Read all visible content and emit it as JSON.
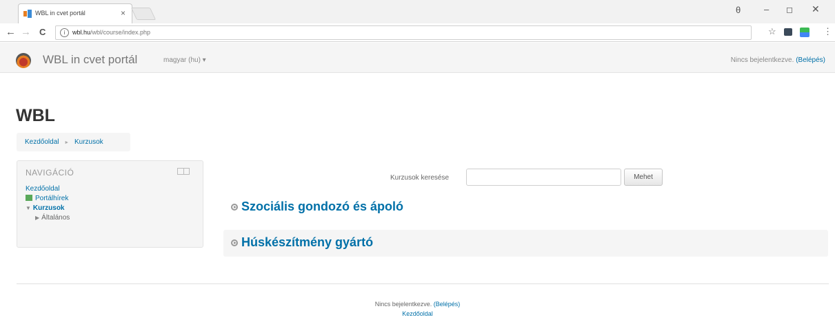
{
  "browser": {
    "tab_title": "WBL in cvet portál",
    "tab_close": "×",
    "url_host": "wbl.hu",
    "url_path": "/wbl/course/index.php",
    "profile_icon": "θ",
    "minimize": "–",
    "maximize": "◻",
    "close": "✕",
    "back": "←",
    "forward": "→",
    "reload": "C",
    "info_icon": "i",
    "star": "☆",
    "menu": "⋮"
  },
  "header": {
    "site_name": "WBL in cvet portál",
    "language": "magyar (hu) ▾",
    "login_status": "Nincs bejelentkezve.",
    "login_link": "(Belépés)"
  },
  "page": {
    "title": "WBL",
    "breadcrumb": {
      "home": "Kezdőoldal",
      "separator": "►",
      "current": "Kurzusok"
    }
  },
  "navigation": {
    "title": "NAVIGÁCIÓ",
    "items": [
      {
        "label": "Kezdőoldal"
      },
      {
        "label": "Portálhírek"
      },
      {
        "label": "Kurzusok"
      },
      {
        "label": "Általános"
      }
    ]
  },
  "search": {
    "label": "Kurzusok keresése",
    "value": "",
    "button": "Mehet"
  },
  "categories": [
    {
      "name": "Szociális gondozó és ápoló"
    },
    {
      "name": "Húskészítmény gyártó"
    }
  ],
  "footer": {
    "login_status": "Nincs bejelentkezve.",
    "login_link": "(Belépés)",
    "home_link": "Kezdőoldal"
  },
  "colors": {
    "link": "#0070a8",
    "panel_bg": "#f5f5f5"
  }
}
